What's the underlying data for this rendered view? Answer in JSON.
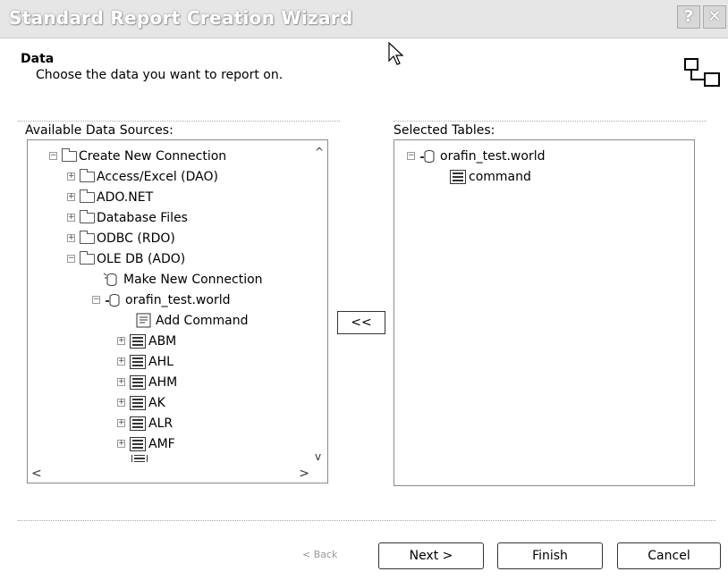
{
  "window": {
    "title": "Standard Report Creation Wizard",
    "help_glyph": "?",
    "close_glyph": "✕"
  },
  "header": {
    "title": "Data",
    "subtitle": "Choose the data you want to report on."
  },
  "available": {
    "label": "Available Data Sources:",
    "items": [
      {
        "label": "Create New Connection",
        "expander": "−"
      },
      {
        "label": "Access/Excel (DAO)",
        "expander": "+"
      },
      {
        "label": "ADO.NET",
        "expander": "+"
      },
      {
        "label": "Database Files",
        "expander": "+"
      },
      {
        "label": "ODBC (RDO)",
        "expander": "+"
      },
      {
        "label": "OLE DB (ADO)",
        "expander": "−"
      },
      {
        "label": "Make New Connection"
      },
      {
        "label": "orafin_test.world",
        "expander": "−"
      },
      {
        "label": "Add Command"
      },
      {
        "label": "ABM",
        "expander": "+"
      },
      {
        "label": "AHL",
        "expander": "+"
      },
      {
        "label": "AHM",
        "expander": "+"
      },
      {
        "label": "AK",
        "expander": "+"
      },
      {
        "label": "ALR",
        "expander": "+"
      },
      {
        "label": "AMF",
        "expander": "+"
      }
    ],
    "scroll_up": "^",
    "scroll_down": "v",
    "scroll_left": "<",
    "scroll_right": ">"
  },
  "selected": {
    "label": "Selected Tables:",
    "items": [
      {
        "label": "orafin_test.world",
        "expander": "−"
      },
      {
        "label": "command"
      }
    ]
  },
  "transfer": {
    "remove_all": "<<"
  },
  "buttons": {
    "back": "< Back",
    "next": "Next >",
    "finish": "Finish",
    "cancel": "Cancel"
  }
}
